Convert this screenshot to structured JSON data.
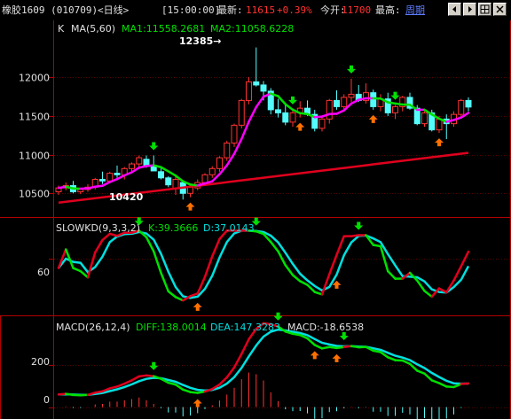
{
  "header": {
    "symbol": "橡胶1609 (010709)",
    "period": "<日线>",
    "time": "[15:00:00]",
    "latest_label": "最新:",
    "latest_value": "11615",
    "change": "+0.39%",
    "open_label": "今开:",
    "open_value": "11700",
    "high_label": "最高:",
    "cycle_link": "周期"
  },
  "colors": {
    "up": "#ff3232",
    "down": "#54fcfc",
    "ma1": "#ff00ff",
    "ma2": "#e0001e",
    "grid": "#8b0000",
    "axis": "#a00000",
    "green": "#00e000",
    "cyan": "#00e0e0",
    "orange": "#ff7000"
  },
  "toolbar": {
    "icons": [
      "left-arrow-icon",
      "right-arrow-icon",
      "grid-icon",
      "close-icon"
    ]
  },
  "price_panel": {
    "indicator_name": "K",
    "ma_label": "MA(5,60)",
    "ma1_label": "MA1:11558.2681",
    "ma2_label": "MA2:11058.6228",
    "yticks": [
      "12000",
      "11500",
      "11000",
      "10500"
    ],
    "yticks_values": [
      12000,
      11500,
      11000,
      10500
    ],
    "ylim": [
      10240,
      12620
    ],
    "max_marker": "12385→",
    "min_marker": "10420",
    "candles": [
      [
        10520,
        10600,
        10480,
        10570
      ],
      [
        10570,
        10640,
        10540,
        10600
      ],
      [
        10600,
        10660,
        10500,
        10520
      ],
      [
        10520,
        10560,
        10490,
        10550
      ],
      [
        10550,
        10620,
        10520,
        10580
      ],
      [
        10580,
        10700,
        10550,
        10680
      ],
      [
        10680,
        10780,
        10620,
        10660
      ],
      [
        10660,
        10780,
        10640,
        10760
      ],
      [
        10760,
        10860,
        10700,
        10740
      ],
      [
        10740,
        10840,
        10680,
        10820
      ],
      [
        10820,
        10900,
        10760,
        10880
      ],
      [
        10880,
        10990,
        10820,
        10960
      ],
      [
        10940,
        10990,
        10830,
        10860
      ],
      [
        10860,
        10990,
        10810,
        10790
      ],
      [
        10780,
        10820,
        10680,
        10700
      ],
      [
        10700,
        10720,
        10580,
        10610
      ],
      [
        10560,
        10720,
        10480,
        10680
      ],
      [
        10640,
        10660,
        10420,
        10500
      ],
      [
        10500,
        10620,
        10450,
        10580
      ],
      [
        10570,
        10680,
        10540,
        10640
      ],
      [
        10640,
        10760,
        10600,
        10740
      ],
      [
        10740,
        10850,
        10700,
        10820
      ],
      [
        10820,
        10980,
        10780,
        10960
      ],
      [
        10960,
        11180,
        10920,
        11150
      ],
      [
        11150,
        11400,
        11100,
        11380
      ],
      [
        11380,
        11720,
        11340,
        11700
      ],
      [
        11700,
        12000,
        11650,
        11940
      ],
      [
        11940,
        12385,
        11880,
        11900
      ],
      [
        11900,
        11950,
        11700,
        11820
      ],
      [
        11820,
        11860,
        11520,
        11580
      ],
      [
        11580,
        11720,
        11480,
        11540
      ],
      [
        11540,
        11660,
        11380,
        11420
      ],
      [
        11420,
        11580,
        11360,
        11540
      ],
      [
        11540,
        11690,
        11480,
        11600
      ],
      [
        11600,
        11700,
        11500,
        11520
      ],
      [
        11520,
        11580,
        11300,
        11340
      ],
      [
        11340,
        11500,
        11300,
        11460
      ],
      [
        11460,
        11720,
        11400,
        11700
      ],
      [
        11700,
        11830,
        11580,
        11620
      ],
      [
        11620,
        11780,
        11560,
        11740
      ],
      [
        11740,
        11980,
        11680,
        11780
      ],
      [
        11780,
        11900,
        11680,
        11700
      ],
      [
        11700,
        11920,
        11660,
        11800
      ],
      [
        11800,
        11840,
        11580,
        11620
      ],
      [
        11620,
        11780,
        11560,
        11720
      ],
      [
        11720,
        11800,
        11500,
        11540
      ],
      [
        11540,
        11640,
        11460,
        11620
      ],
      [
        11620,
        11760,
        11560,
        11740
      ],
      [
        11740,
        11800,
        11580,
        11600
      ],
      [
        11600,
        11640,
        11380,
        11400
      ],
      [
        11400,
        11560,
        11360,
        11540
      ],
      [
        11540,
        11580,
        11300,
        11320
      ],
      [
        11320,
        11500,
        11280,
        11460
      ],
      [
        11460,
        11520,
        11200,
        11400
      ],
      [
        11400,
        11560,
        11360,
        11520
      ],
      [
        11520,
        11720,
        11480,
        11700
      ],
      [
        11700,
        11740,
        11560,
        11615
      ]
    ]
  },
  "kd_panel": {
    "label": "SLOWKD(9,3,3,2)",
    "k_label": "K:39.3666",
    "d_label": "D:37.0143",
    "ytick": "60",
    "ytick_value": 60,
    "ylim": [
      8,
      95
    ]
  },
  "macd_panel": {
    "label": "MACD(26,12,4)",
    "diff_label": "DIFF:138.0014",
    "dea_label": "DEA:147.3283",
    "macd_label": "MACD:-18.6538",
    "yticks": [
      "200",
      "0"
    ],
    "yticks_values": [
      200,
      0
    ],
    "ylim": [
      -40,
      340
    ]
  }
}
